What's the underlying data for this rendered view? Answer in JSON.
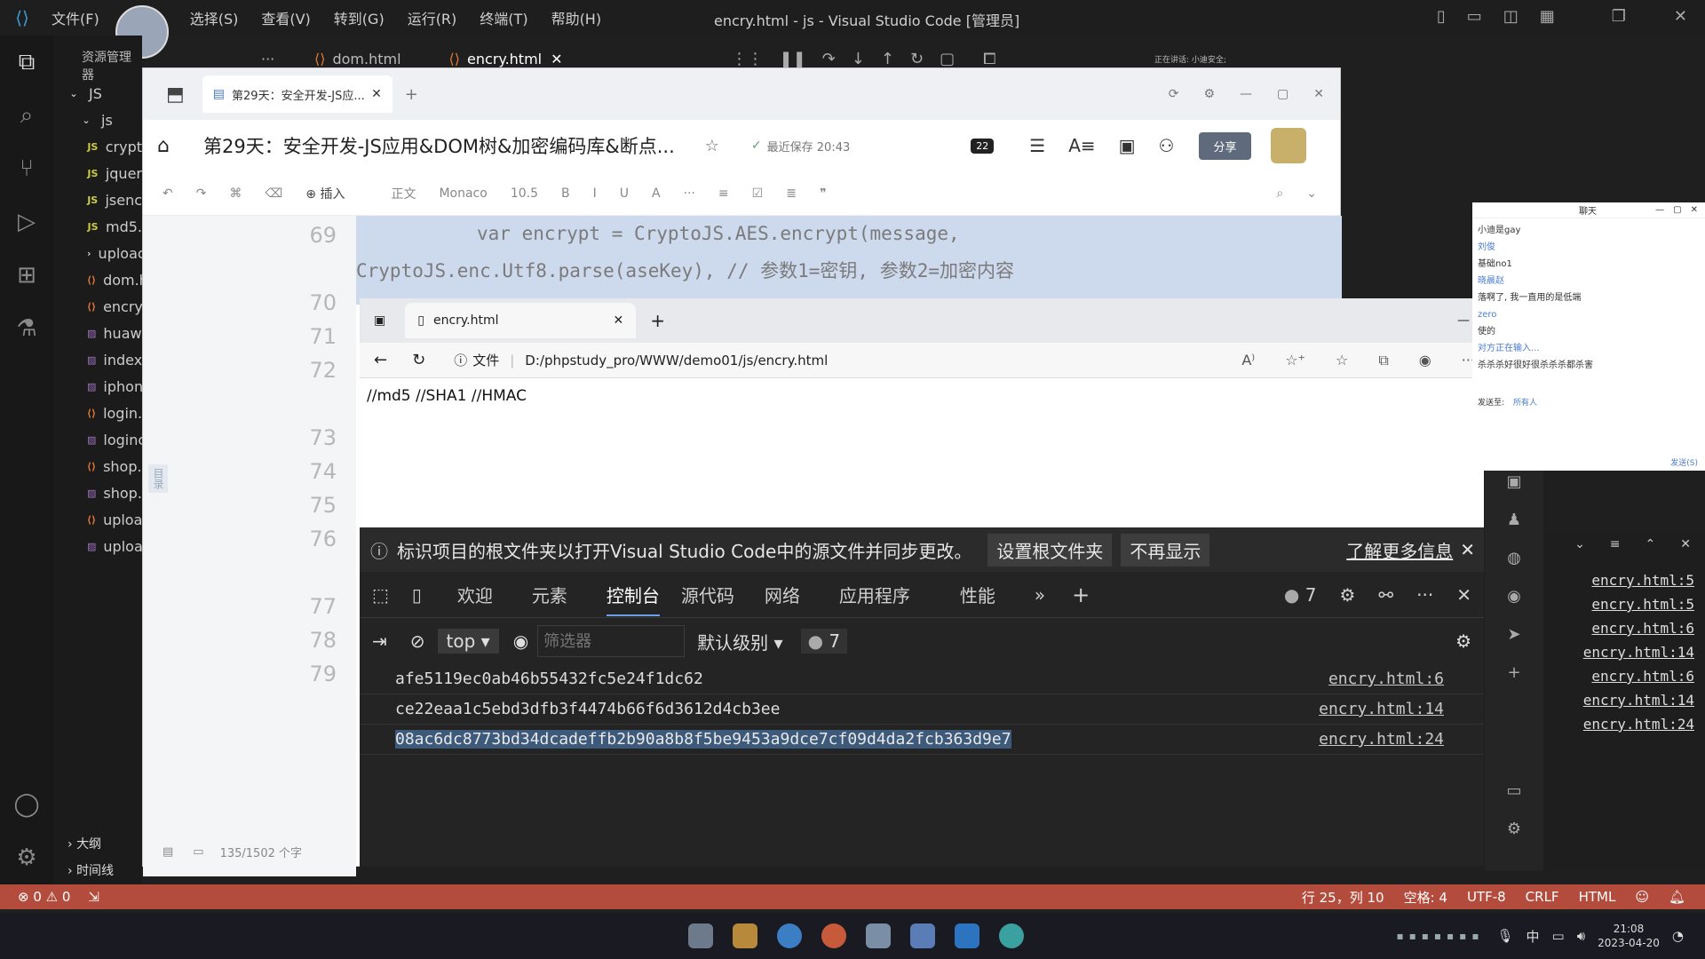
{
  "vscode": {
    "menu": [
      "文件(F)",
      "选择(S)",
      "查看(V)",
      "转到(G)",
      "运行(R)",
      "终端(T)",
      "帮助(H)"
    ],
    "window_title": "encry.html - js - Visual Studio Code [管理员]",
    "explorer_title": "资源管理器",
    "tabs": [
      "dom.html",
      "encry.html"
    ],
    "tree": [
      {
        "label": "JS",
        "icon": "chevron-down-icon"
      },
      {
        "label": "js",
        "icon": "chevron-down-icon"
      },
      {
        "label": "crypt",
        "icon": "JS"
      },
      {
        "label": "jquer",
        "icon": "JS"
      },
      {
        "label": "jsenc",
        "icon": "JS"
      },
      {
        "label": "md5.",
        "icon": "JS"
      },
      {
        "label": "uploac",
        "icon": "chevron-right-icon"
      },
      {
        "label": "dom.h",
        "icon": "<>"
      },
      {
        "label": "encry.h",
        "icon": "<>"
      },
      {
        "label": "huawe",
        "icon": "img"
      },
      {
        "label": "index.",
        "icon": "img"
      },
      {
        "label": "iphone",
        "icon": "img"
      },
      {
        "label": "login.h",
        "icon": "<>"
      },
      {
        "label": "loginc",
        "icon": "img"
      },
      {
        "label": "shop.h",
        "icon": "<>"
      },
      {
        "label": "shop.p",
        "icon": "img"
      },
      {
        "label": "uploac",
        "icon": "<>"
      },
      {
        "label": "uploac",
        "icon": "img"
      }
    ],
    "outline": "大纲",
    "timeline": "时间线",
    "status": {
      "errors": "0",
      "warnings": "0",
      "position": "行 25，列 10",
      "spaces": "空格: 4",
      "encoding": "UTF-8",
      "eol": "CRLF",
      "language": "HTML"
    },
    "share_label": "正在讲话: 小迪安全;"
  },
  "doc": {
    "tab_title": "第29天：安全开发-JS应...",
    "title": "第29天：安全开发-JS应用&DOM树&加密编码库&断点...",
    "saved": "最近保存 20:43",
    "share": "分享",
    "badge": "22",
    "toolbar": [
      "插入",
      "正文",
      "Monaco",
      "10.5"
    ],
    "line_numbers": [
      "69",
      "70",
      "71",
      "72",
      "73",
      "74",
      "75",
      "76",
      "77",
      "78",
      "79"
    ],
    "code_line_1": "var encrypt = CryptoJS.AES.encrypt(message,",
    "code_line_2": "CryptoJS.enc.Utf8.parse(aseKey), // 参数1=密钥, 参数2=加密内容",
    "side_tab": "目录",
    "word_count": "135/1502 个字"
  },
  "browser": {
    "tab": "encry.html",
    "file_label": "文件",
    "path": "D:/phpstudy_pro/WWW/demo01/js/encry.html",
    "page_text": "//md5 //SHA1 //HMAC"
  },
  "devtools": {
    "notice": "标识项目的根文件夹以打开Visual Studio Code中的源文件并同步更改。",
    "set_root": "设置根文件夹",
    "dont_show": "不再显示",
    "learn_more": "了解更多信息",
    "tabs": [
      "欢迎",
      "元素",
      "控制台",
      "源代码",
      "网络",
      "应用程序",
      "性能"
    ],
    "issue_count": "7",
    "context": "top",
    "filter_placeholder": "筛选器",
    "level": "默认级别",
    "console_count": "7",
    "rows": [
      {
        "text": "afe5119ec0ab46b55432fc5e24f1dc62",
        "src": "encry.html:6"
      },
      {
        "text": "ce22eaa1c5ebd3dfb3f4474b66f6d3612d4cb3ee",
        "src": "encry.html:14"
      },
      {
        "text": "08ac6dc8773bd34dcadeffb2b90a8b8f5be9453a9dce7cf09d4da2fcb363d9e7",
        "src": "encry.html:24"
      }
    ]
  },
  "side_links": [
    "encry.html:5",
    "encry.html:5",
    "encry.html:6",
    "encry.html:14",
    "encry.html:6",
    "encry.html:14",
    "encry.html:24"
  ],
  "chat": {
    "title": "聊天",
    "lines": [
      "小迪是gay",
      "刘俊",
      "基础no1",
      "晓晨赵",
      "落啊了, 我一直用的是低端",
      "zero",
      "使的",
      "对方正在输入...",
      "杀杀杀好很好很杀杀杀都杀害"
    ],
    "send_to": "发送至:",
    "everyone": "所有人",
    "send": "发送(S)"
  },
  "taskbar": {
    "time": "21:08",
    "date": "2023-04-20",
    "ime": "中"
  }
}
